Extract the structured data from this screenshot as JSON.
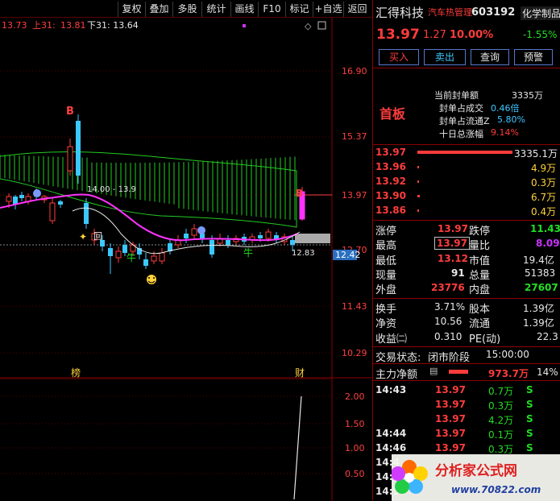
{
  "toolbar": {
    "items": [
      "复权",
      "叠加",
      "多股",
      "统计",
      "画线",
      "F10",
      "标记",
      "+自选",
      "返回"
    ]
  },
  "chart": {
    "header_price": "13.73",
    "header_upper_label": "上31:",
    "header_upper_value": "13.81",
    "header_lower": "下31: 13.64",
    "price_axis": [
      "16.90",
      "15.37",
      "13.97",
      "12.70",
      "11.43",
      "10.29"
    ],
    "current_price_tag": "12.42",
    "annot_upper": "14.00 - 13.9",
    "annot_lower": "12.83",
    "marker_b": "B",
    "marker_niu": "牛",
    "marker_bang": "榜",
    "marker_cai": "财",
    "marker_hui": "回",
    "sub_axis": [
      "2.00",
      "1.50",
      "1.00",
      "0.50"
    ],
    "watermark": "www.70822.com 分析家公式网"
  },
  "panel": {
    "stock_name": "汇得科技",
    "sector_tag": "汽车热管理",
    "stock_code": "603192",
    "industry": "化学制品",
    "price": "13.97",
    "change": "1.27",
    "change_pct": "10.00%",
    "industry_change": "-1.55%",
    "buttons": [
      "买入",
      "卖出",
      "查询",
      "预警"
    ],
    "board_label": "首板",
    "limit_info": [
      {
        "label": "当前封单额",
        "value": "3335万"
      },
      {
        "label": "封单占成交",
        "value": "0.46倍"
      },
      {
        "label": "封单占流通Z",
        "value": "5.80%"
      },
      {
        "label": "十日总涨幅",
        "value": "9.14%"
      }
    ],
    "order_book": [
      {
        "price": "13.97",
        "vol": "3335.1万"
      },
      {
        "price": "13.96",
        "vol": "4.9万"
      },
      {
        "price": "13.92",
        "vol": "0.3万"
      },
      {
        "price": "13.90",
        "vol": "6.7万"
      },
      {
        "price": "13.86",
        "vol": "0.4万"
      }
    ],
    "quotes": [
      {
        "l1": "涨停",
        "v1": "13.97",
        "l2": "跌停",
        "v2": "11.43"
      },
      {
        "l1": "最高",
        "v1": "13.97",
        "l2": "量比",
        "v2": "8.09"
      },
      {
        "l1": "最低",
        "v1": "13.12",
        "l2": "市值",
        "v2": "19.4亿"
      },
      {
        "l1": "现量",
        "v1": "91",
        "l2": "总量",
        "v2": "51383"
      },
      {
        "l1": "外盘",
        "v1": "23776",
        "l2": "内盘",
        "v2": "27607"
      }
    ],
    "fundamentals": [
      {
        "l1": "换手",
        "v1": "3.71%",
        "l2": "股本",
        "v2": "1.39亿"
      },
      {
        "l1": "净资",
        "v1": "10.56",
        "l2": "流通",
        "v2": "1.39亿"
      },
      {
        "l1": "收益㈡",
        "v1": "0.310",
        "l2": "PE(动)",
        "v2": "22.3"
      }
    ],
    "trade_status_label": "交易状态:",
    "trade_status_value": "闭市阶段",
    "trade_status_time": "15:00:00",
    "net_flow_label": "主力净额",
    "net_flow_value": "973.7万",
    "net_flow_pct": "14%",
    "ticks": [
      {
        "time": "14:43",
        "price": "13.97",
        "vol": "0.7万",
        "side": "S"
      },
      {
        "time": "",
        "price": "13.97",
        "vol": "0.3万",
        "side": "S"
      },
      {
        "time": "",
        "price": "13.97",
        "vol": "4.2万",
        "side": "S"
      },
      {
        "time": "14:44",
        "price": "13.97",
        "vol": "0.1万",
        "side": "S"
      },
      {
        "time": "14:46",
        "price": "13.97",
        "vol": "0.3万",
        "side": "S"
      },
      {
        "time": "14:4",
        "price": "",
        "vol": "",
        "side": ""
      },
      {
        "time": "14:5",
        "price": "",
        "vol": "",
        "side": ""
      },
      {
        "time": "14:5",
        "price": "",
        "vol": "",
        "side": ""
      }
    ],
    "logo_text": "分析家公式网",
    "logo_url": "www.70822.com"
  },
  "colors": {
    "up": "#ff3c3c",
    "down": "#22dd22",
    "cloud": "#22cc22",
    "ma": "#ff33ff",
    "candle_up": "#ff3c3c",
    "candle_down": "#3cc8ff"
  }
}
